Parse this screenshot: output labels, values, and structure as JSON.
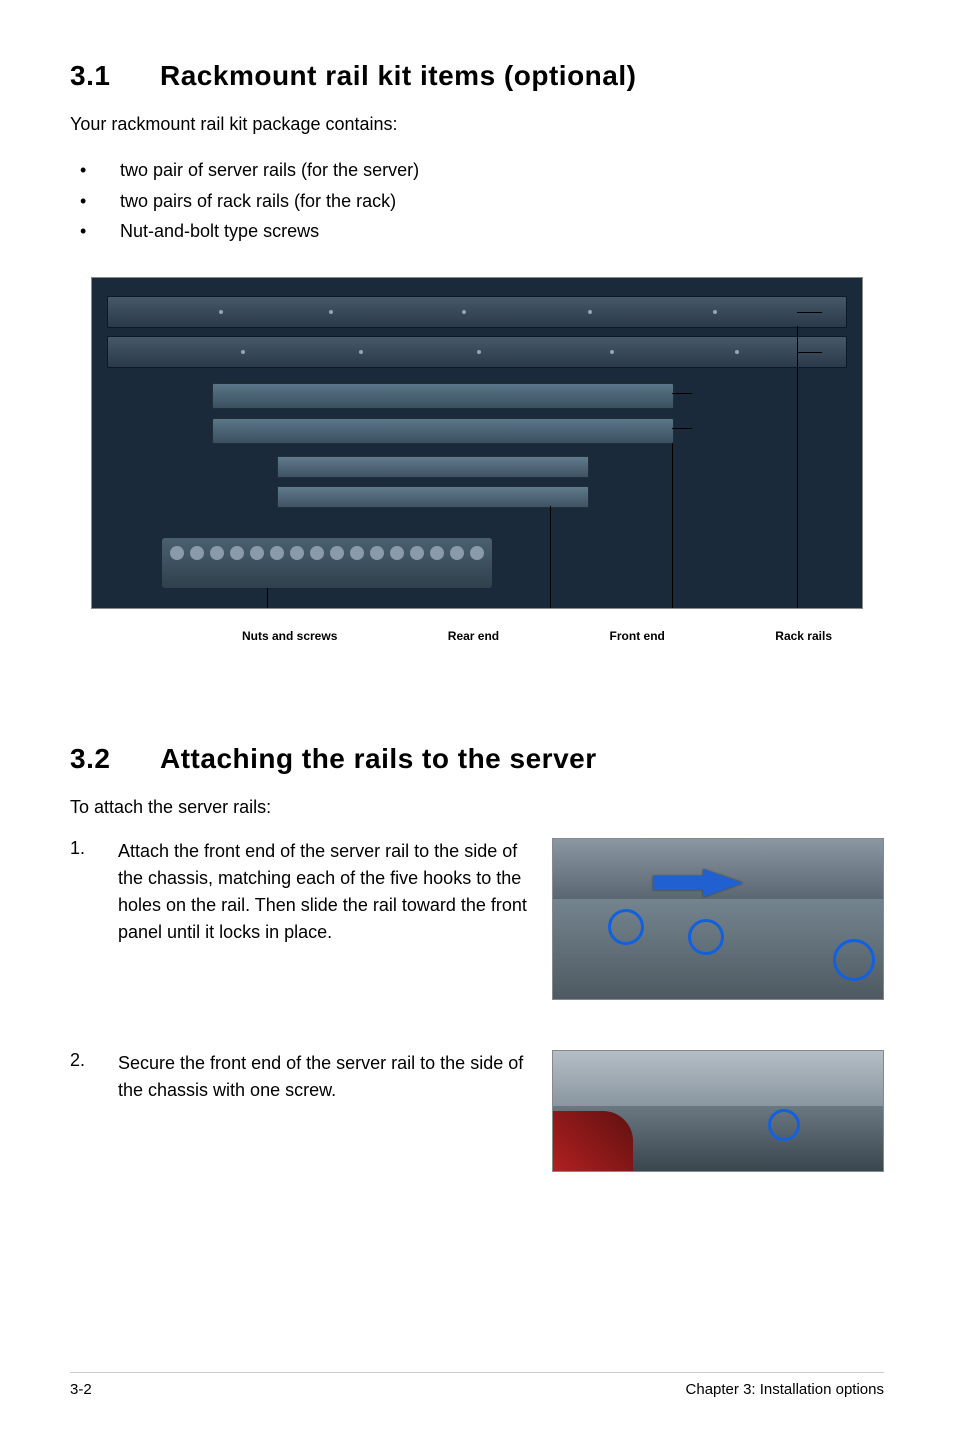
{
  "section1": {
    "number": "3.1",
    "title": "Rackmount rail kit items (optional)",
    "intro": "Your rackmount rail kit package contains:",
    "bullets": [
      "two pair of server rails (for the server)",
      "two pairs of rack rails (for the rack)",
      "Nut-and-bolt type screws"
    ],
    "labels": {
      "nuts": "Nuts and screws",
      "rear": "Rear end",
      "front": "Front end",
      "rack": "Rack rails"
    }
  },
  "section2": {
    "number": "3.2",
    "title": "Attaching the rails to the server",
    "intro": "To attach the server rails:",
    "steps": [
      {
        "n": "1.",
        "text": "Attach the front end of the server rail to the side of the chassis, matching each of the five hooks to the holes on the rail. Then slide the rail toward the front panel until it locks in place."
      },
      {
        "n": "2.",
        "text": "Secure the front end of the server rail to the side of the chassis with one screw."
      }
    ]
  },
  "footer": {
    "left": "3-2",
    "right": "Chapter 3:  Installation options"
  }
}
